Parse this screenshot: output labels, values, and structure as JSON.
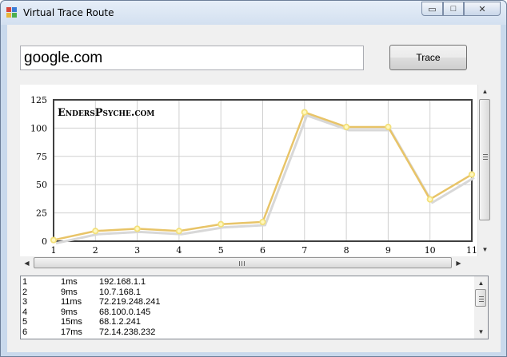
{
  "window": {
    "title": "Virtual Trace Route",
    "minimize_glyph": "▭",
    "maximize_glyph": "□",
    "close_glyph": "✕"
  },
  "form": {
    "host_value": "google.com",
    "trace_label": "Trace"
  },
  "chart_data": {
    "type": "line",
    "watermark": "EndersPsyche.com",
    "x": [
      1,
      2,
      3,
      4,
      5,
      6,
      7,
      8,
      9,
      10,
      11
    ],
    "y": [
      1,
      9,
      11,
      9,
      15,
      17,
      114,
      101,
      101,
      37,
      59
    ],
    "xlim": [
      1,
      11
    ],
    "ylim": [
      0,
      125
    ],
    "yticks": [
      0,
      25,
      50,
      75,
      100,
      125
    ],
    "xticks": [
      1,
      2,
      3,
      4,
      5,
      6,
      7,
      8,
      9,
      10,
      11
    ],
    "grid": true,
    "line_color": "#e8c468",
    "marker_color": "#f3e07a"
  },
  "results": [
    {
      "hop": "1",
      "time": "1ms",
      "ip": "192.168.1.1"
    },
    {
      "hop": "2",
      "time": "9ms",
      "ip": "10.7.168.1"
    },
    {
      "hop": "3",
      "time": "11ms",
      "ip": "72.219.248.241"
    },
    {
      "hop": "4",
      "time": "9ms",
      "ip": "68.100.0.145"
    },
    {
      "hop": "5",
      "time": "15ms",
      "ip": "68.1.2.241"
    },
    {
      "hop": "6",
      "time": "17ms",
      "ip": "72.14.238.232"
    }
  ],
  "icons": {
    "app": "app-icon",
    "scroll_up": "▲",
    "scroll_down": "▼",
    "scroll_left": "◀",
    "scroll_right": "▶"
  }
}
